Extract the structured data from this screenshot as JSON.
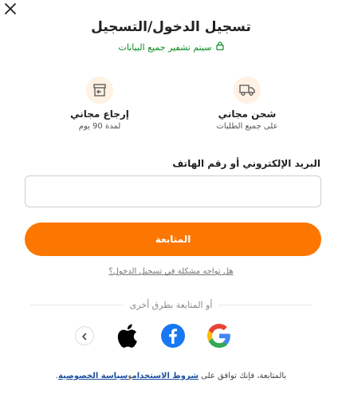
{
  "title": "تسجيل الدخول/التسجيل",
  "secure_text": "سيتم تشفير جميع البيانات",
  "benefits": [
    {
      "title": "شحن مجاني",
      "subtitle": "على جميع الطلبات",
      "icon": "truck-icon"
    },
    {
      "title": "إرجاع مجاني",
      "subtitle": "لمدة 90 يوم",
      "icon": "return-box-icon"
    }
  ],
  "form": {
    "label": "البريد الإلكتروني أو رقم الهاتف",
    "value": "",
    "continue_label": "المتابعة"
  },
  "trouble_link": "هل تواجه مشكلة في تسجيل الدخول؟",
  "divider_text": "أو المتابعة بطرق أخرى",
  "social": [
    "google-icon",
    "facebook-icon",
    "apple-icon"
  ],
  "terms": {
    "prefix": "بالمتابعة، فإنك توافق على",
    "terms_link": "شروط الاستخدام",
    "and": "و",
    "privacy_link": "سياسة الخصوصية",
    "suffix": "."
  },
  "colors": {
    "accent": "#fb7701",
    "secure": "#0a8a1f",
    "link": "#1d4e9e",
    "facebook": "#1877f2"
  }
}
